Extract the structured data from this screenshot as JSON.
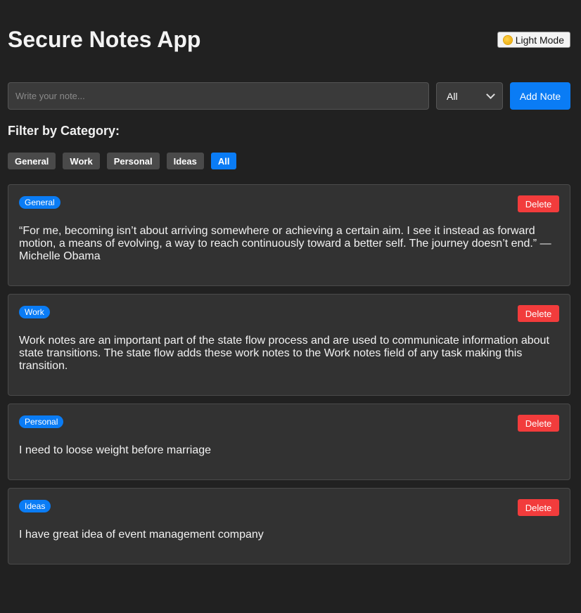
{
  "header": {
    "title": "Secure Notes App",
    "mode_toggle_label": "Light Mode",
    "mode_toggle_icon": "sun-icon"
  },
  "composer": {
    "note_placeholder": "Write your note...",
    "note_value": "",
    "category_selected": "All",
    "add_label": "Add Note"
  },
  "filters": {
    "heading": "Filter by Category:",
    "items": [
      {
        "label": "General",
        "active": false
      },
      {
        "label": "Work",
        "active": false
      },
      {
        "label": "Personal",
        "active": false
      },
      {
        "label": "Ideas",
        "active": false
      },
      {
        "label": "All",
        "active": true
      }
    ]
  },
  "notes": [
    {
      "category": "General",
      "text": "“For me, becoming isn’t about arriving somewhere or achieving a certain aim. I see it instead as forward motion, a means of evolving, a way to reach continuously toward a better self. The journey doesn’t end.” — Michelle Obama",
      "delete_label": "Delete"
    },
    {
      "category": "Work",
      "text": "Work notes are an important part of the state flow process and are used to communicate information about state transitions. The state flow adds these work notes to the Work notes field of any task making this transition.",
      "delete_label": "Delete"
    },
    {
      "category": "Personal",
      "text": "I need to loose weight before marriage",
      "delete_label": "Delete"
    },
    {
      "category": "Ideas",
      "text": "I have great idea of event management company",
      "delete_label": "Delete"
    }
  ],
  "colors": {
    "background": "#212121",
    "accent": "#0a7cf5",
    "danger": "#f23c3c",
    "card": "#323232"
  }
}
